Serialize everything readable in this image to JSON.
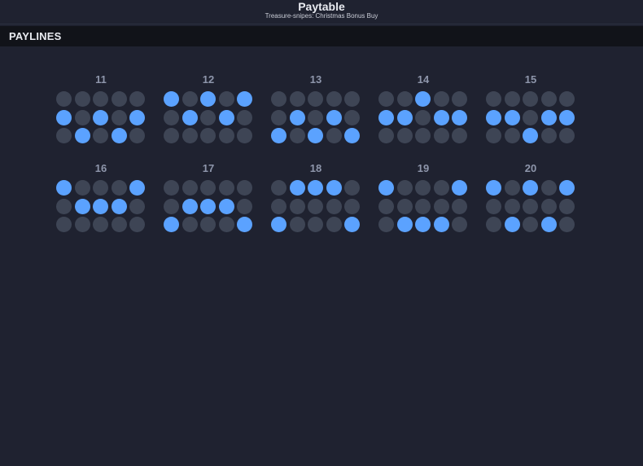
{
  "header": {
    "title": "Paytable",
    "subtitle": "Treasure-snipes: Christmas Bonus Buy"
  },
  "section": {
    "title": "PAYLINES"
  },
  "colors": {
    "background": "#1f2230",
    "section_bar": "#111319",
    "dot_off": "#3e4555",
    "dot_on": "#5ba2ff",
    "number": "#8e96ab"
  },
  "paylines": [
    {
      "number": "11",
      "rows": [
        [
          0,
          0,
          0,
          0,
          0
        ],
        [
          1,
          0,
          1,
          0,
          1
        ],
        [
          0,
          1,
          0,
          1,
          0
        ]
      ]
    },
    {
      "number": "12",
      "rows": [
        [
          1,
          0,
          1,
          0,
          1
        ],
        [
          0,
          1,
          0,
          1,
          0
        ],
        [
          0,
          0,
          0,
          0,
          0
        ]
      ]
    },
    {
      "number": "13",
      "rows": [
        [
          0,
          0,
          0,
          0,
          0
        ],
        [
          0,
          1,
          0,
          1,
          0
        ],
        [
          1,
          0,
          1,
          0,
          1
        ]
      ]
    },
    {
      "number": "14",
      "rows": [
        [
          0,
          0,
          1,
          0,
          0
        ],
        [
          1,
          1,
          0,
          1,
          1
        ],
        [
          0,
          0,
          0,
          0,
          0
        ]
      ]
    },
    {
      "number": "15",
      "rows": [
        [
          0,
          0,
          0,
          0,
          0
        ],
        [
          1,
          1,
          0,
          1,
          1
        ],
        [
          0,
          0,
          1,
          0,
          0
        ]
      ]
    },
    {
      "number": "16",
      "rows": [
        [
          1,
          0,
          0,
          0,
          1
        ],
        [
          0,
          1,
          1,
          1,
          0
        ],
        [
          0,
          0,
          0,
          0,
          0
        ]
      ]
    },
    {
      "number": "17",
      "rows": [
        [
          0,
          0,
          0,
          0,
          0
        ],
        [
          0,
          1,
          1,
          1,
          0
        ],
        [
          1,
          0,
          0,
          0,
          1
        ]
      ]
    },
    {
      "number": "18",
      "rows": [
        [
          0,
          1,
          1,
          1,
          0
        ],
        [
          0,
          0,
          0,
          0,
          0
        ],
        [
          1,
          0,
          0,
          0,
          1
        ]
      ]
    },
    {
      "number": "19",
      "rows": [
        [
          1,
          0,
          0,
          0,
          1
        ],
        [
          0,
          0,
          0,
          0,
          0
        ],
        [
          0,
          1,
          1,
          1,
          0
        ]
      ]
    },
    {
      "number": "20",
      "rows": [
        [
          1,
          0,
          1,
          0,
          1
        ],
        [
          0,
          0,
          0,
          0,
          0
        ],
        [
          0,
          1,
          0,
          1,
          0
        ]
      ]
    }
  ]
}
